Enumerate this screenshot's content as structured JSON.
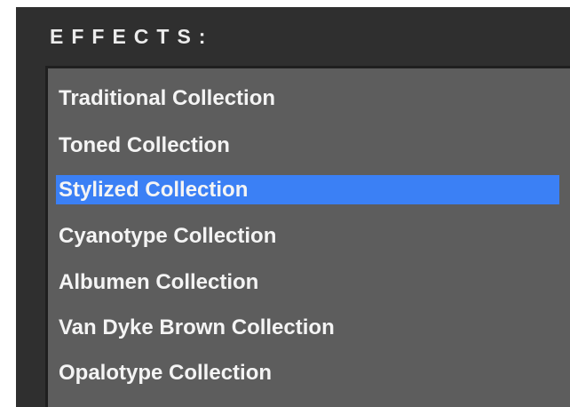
{
  "panel": {
    "title": "EFFECTS:"
  },
  "effects_list": {
    "items": [
      {
        "label": "Traditional Collection",
        "selected": false
      },
      {
        "label": "Toned Collection",
        "selected": false
      },
      {
        "label": "Stylized Collection",
        "selected": true
      },
      {
        "label": "Cyanotype Collection",
        "selected": false
      },
      {
        "label": "Albumen Collection",
        "selected": false
      },
      {
        "label": "Van Dyke Brown Collection",
        "selected": false
      },
      {
        "label": "Opalotype Collection",
        "selected": false
      }
    ]
  },
  "colors": {
    "panel_background": "#2f2f2f",
    "list_background": "#5d5d5d",
    "selection_highlight": "#3b80f5",
    "text": "#f4f4f4"
  }
}
